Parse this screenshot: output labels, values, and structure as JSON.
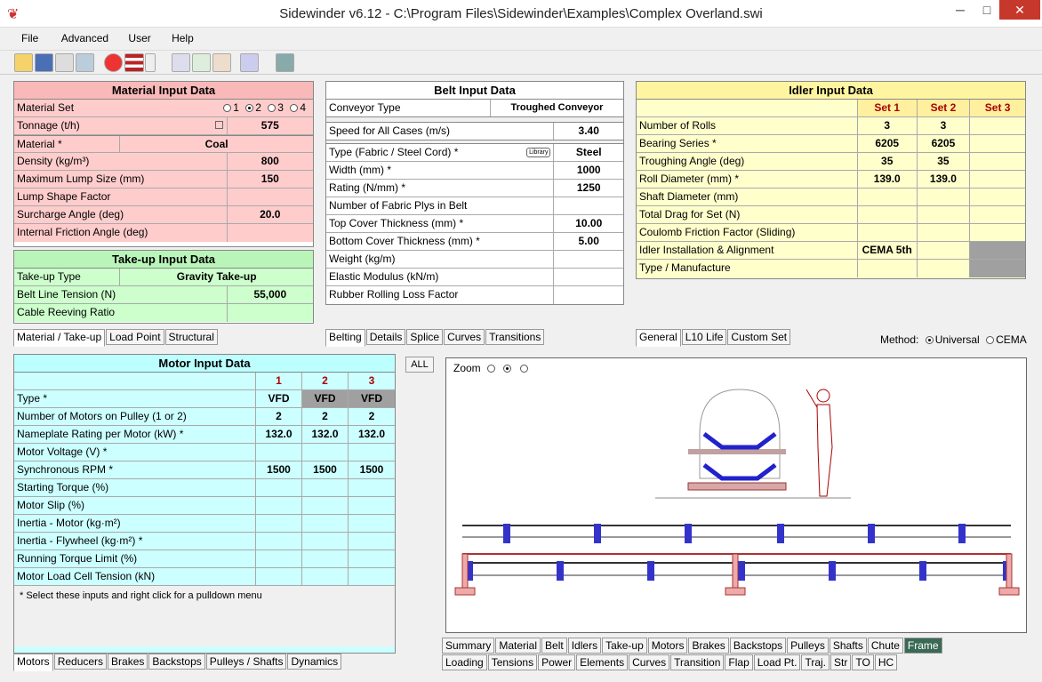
{
  "window": {
    "title": "Sidewinder v6.12 - C:\\Program Files\\Sidewinder\\Examples\\Complex Overland.swi",
    "minimize": "─",
    "maximize": "□",
    "close": "✕"
  },
  "menu": [
    "File",
    "Advanced",
    "User",
    "Help"
  ],
  "material": {
    "title": "Material Input Data",
    "set_label": "Material Set",
    "set_options": [
      "1",
      "2",
      "3",
      "4"
    ],
    "tonnage_label": "Tonnage (t/h)",
    "tonnage_value": "575",
    "material_label": "Material *",
    "material_value": "Coal",
    "density_label": "Density (kg/m³)",
    "density_value": "800",
    "lump_label": "Maximum Lump Size (mm)",
    "lump_value": "150",
    "shape_label": "Lump Shape Factor",
    "surcharge_label": "Surcharge Angle (deg)",
    "surcharge_value": "20.0",
    "friction_label": "Internal Friction Angle (deg)"
  },
  "takeup": {
    "title": "Take-up Input Data",
    "type_label": "Take-up Type",
    "type_value": "Gravity Take-up",
    "tension_label": "Belt Line Tension (N)",
    "tension_value": "55,000",
    "reeving_label": "Cable Reeving Ratio"
  },
  "left_tabs": [
    "Material / Take-up",
    "Load Point",
    "Structural"
  ],
  "belt": {
    "title": "Belt Input Data",
    "conveyor_label": "Conveyor Type",
    "conveyor_value": "Troughed Conveyor",
    "speed_label": "Speed for All Cases (m/s)",
    "speed_value": "3.40",
    "type_label": "Type (Fabric / Steel Cord) *",
    "library": "Library",
    "type_value": "Steel",
    "width_label": "Width (mm) *",
    "width_value": "1000",
    "rating_label": "Rating (N/mm) *",
    "rating_value": "1250",
    "plys_label": "Number of Fabric Plys in Belt",
    "top_label": "Top Cover Thickness (mm) *",
    "top_value": "10.00",
    "bottom_label": "Bottom Cover Thickness (mm) *",
    "bottom_value": "5.00",
    "weight_label": "Weight (kg/m)",
    "modulus_label": "Elastic Modulus (kN/m)",
    "rubber_label": "Rubber Rolling Loss Factor"
  },
  "belt_tabs": [
    "Belting",
    "Details",
    "Splice",
    "Curves",
    "Transitions"
  ],
  "idler": {
    "title": "Idler Input Data",
    "sets": [
      "Set 1",
      "Set 2",
      "Set 3"
    ],
    "rows": [
      {
        "label": "Number of Rolls",
        "v": [
          "3",
          "3",
          ""
        ]
      },
      {
        "label": "Bearing Series *",
        "v": [
          "6205",
          "6205",
          ""
        ]
      },
      {
        "label": "Troughing Angle (deg)",
        "v": [
          "35",
          "35",
          ""
        ]
      },
      {
        "label": "Roll Diameter (mm) *",
        "v": [
          "139.0",
          "139.0",
          ""
        ]
      },
      {
        "label": "Shaft Diameter (mm)",
        "v": [
          "",
          "",
          ""
        ]
      },
      {
        "label": "Total Drag for Set (N)",
        "v": [
          "",
          "",
          ""
        ]
      },
      {
        "label": "Coulomb Friction Factor (Sliding)",
        "v": [
          "",
          "",
          ""
        ]
      },
      {
        "label": "Idler Installation & Alignment",
        "v": [
          "CEMA 5th",
          "",
          ""
        ]
      },
      {
        "label": "Type / Manufacture",
        "v": [
          "",
          "",
          ""
        ]
      }
    ]
  },
  "idler_tabs": [
    "General",
    "L10 Life",
    "Custom Set"
  ],
  "method": {
    "label": "Method:",
    "opt1": "Universal",
    "opt2": "CEMA"
  },
  "motor": {
    "title": "Motor Input Data",
    "cols": [
      "1",
      "2",
      "3"
    ],
    "rows": [
      {
        "label": "Type *",
        "v": [
          "VFD",
          "VFD",
          "VFD"
        ]
      },
      {
        "label": "Number of Motors on Pulley (1 or 2)",
        "v": [
          "2",
          "2",
          "2"
        ]
      },
      {
        "label": "Nameplate Rating per Motor (kW) *",
        "v": [
          "132.0",
          "132.0",
          "132.0"
        ]
      },
      {
        "label": "Motor Voltage (V) *",
        "v": [
          "",
          "",
          ""
        ]
      },
      {
        "label": "Synchronous RPM *",
        "v": [
          "1500",
          "1500",
          "1500"
        ]
      },
      {
        "label": "Starting Torque (%)",
        "v": [
          "",
          "",
          ""
        ]
      },
      {
        "label": "Motor Slip (%)",
        "v": [
          "",
          "",
          ""
        ]
      },
      {
        "label": "Inertia - Motor (kg·m²)",
        "v": [
          "",
          "",
          ""
        ]
      },
      {
        "label": "Inertia - Flywheel (kg·m²) *",
        "v": [
          "",
          "",
          ""
        ]
      },
      {
        "label": "Running Torque Limit (%)",
        "v": [
          "",
          "",
          ""
        ]
      },
      {
        "label": "Motor Load Cell Tension (kN)",
        "v": [
          "",
          "",
          ""
        ]
      }
    ],
    "note": "* Select these inputs and right click for a pulldown menu"
  },
  "motor_tabs": [
    "Motors",
    "Reducers",
    "Brakes",
    "Backstops",
    "Pulleys / Shafts",
    "Dynamics"
  ],
  "all_label": "ALL",
  "zoom_label": "Zoom",
  "bottom_tabs_row1": [
    "Summary",
    "Material",
    "Belt",
    "Idlers",
    "Take-up",
    "Motors",
    "Brakes",
    "Backstops",
    "Pulleys",
    "Shafts",
    "Chute",
    "Frame"
  ],
  "bottom_tabs_row2": [
    "Loading",
    "Tensions",
    "Power",
    "Elements",
    "Curves",
    "Transition",
    "Flap",
    "Load Pt.",
    "Traj.",
    "Str",
    "TO",
    "HC"
  ]
}
